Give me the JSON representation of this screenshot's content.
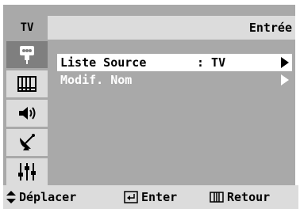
{
  "header": {
    "tv_label": "TV",
    "title": "Entrée"
  },
  "sidebar": {
    "items": [
      {
        "icon": "input-icon",
        "active": true
      },
      {
        "icon": "picture-icon",
        "active": false
      },
      {
        "icon": "sound-icon",
        "active": false
      },
      {
        "icon": "channel-icon",
        "active": false
      },
      {
        "icon": "setup-icon",
        "active": false
      }
    ]
  },
  "menu": {
    "items": [
      {
        "label": "Liste Source",
        "value": ": TV",
        "selected": true
      },
      {
        "label": "Modif. Nom",
        "value": "",
        "selected": false
      }
    ]
  },
  "footer": {
    "move_label": "Déplacer",
    "enter_label": "Enter",
    "return_label": "Retour"
  },
  "colors": {
    "panel": "#a9a9a9",
    "bar": "#dcdcdc",
    "highlight": "#ffffff",
    "text": "#ffffff"
  }
}
